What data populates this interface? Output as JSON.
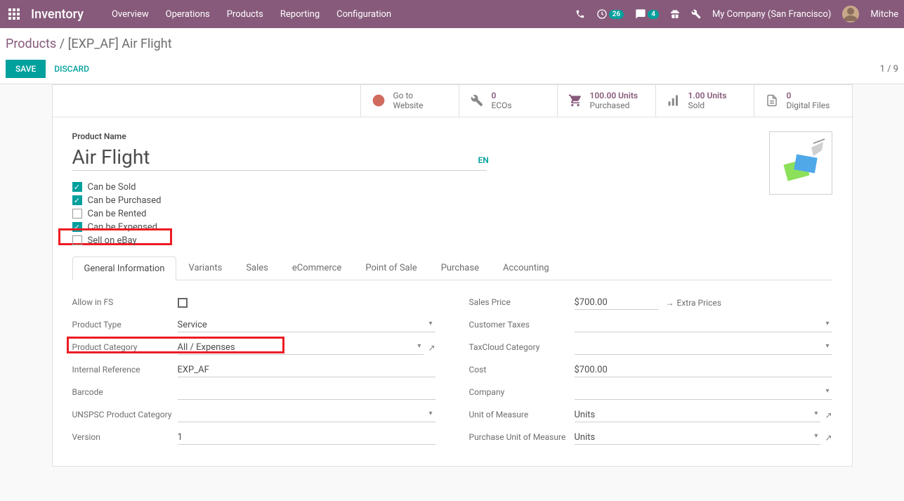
{
  "navbar": {
    "brand": "Inventory",
    "menu": [
      "Overview",
      "Operations",
      "Products",
      "Reporting",
      "Configuration"
    ],
    "activities_count": "26",
    "messages_count": "4",
    "company": "My Company (San Francisco)",
    "username": "Mitche"
  },
  "breadcrumb": {
    "root": "Products",
    "sep": " / ",
    "current": "[EXP_AF] Air Flight"
  },
  "actions": {
    "save": "SAVE",
    "discard": "DISCARD",
    "pager": "1 / 9"
  },
  "stats": {
    "website": {
      "l1": "Go to",
      "l2": "Website"
    },
    "ecos": {
      "val": "0",
      "lbl": "ECOs"
    },
    "purchased": {
      "val": "100.00 Units",
      "lbl": "Purchased"
    },
    "sold": {
      "val": "1.00 Units",
      "lbl": "Sold"
    },
    "files": {
      "val": "0",
      "lbl": "Digital Files"
    }
  },
  "product": {
    "name_label": "Product Name",
    "name": "Air Flight",
    "lang": "EN"
  },
  "checks": {
    "sold": "Can be Sold",
    "purchased": "Can be Purchased",
    "rented": "Can be Rented",
    "expensed": "Can be Expensed",
    "ebay": "Sell on eBay"
  },
  "tabs": [
    "General Information",
    "Variants",
    "Sales",
    "eCommerce",
    "Point of Sale",
    "Purchase",
    "Accounting"
  ],
  "left_fields": {
    "allow_fs": "Allow in FS",
    "product_type": {
      "label": "Product Type",
      "value": "Service"
    },
    "product_category": {
      "label": "Product Category",
      "value": "All / Expenses"
    },
    "internal_ref": {
      "label": "Internal Reference",
      "value": "EXP_AF"
    },
    "barcode": {
      "label": "Barcode",
      "value": ""
    },
    "unspsc": {
      "label": "UNSPSC Product Category",
      "value": ""
    },
    "version": {
      "label": "Version",
      "value": "1"
    }
  },
  "right_fields": {
    "sales_price": {
      "label": "Sales Price",
      "value": "$700.00"
    },
    "extra_prices": "Extra Prices",
    "customer_taxes": {
      "label": "Customer Taxes",
      "value": ""
    },
    "taxcloud": {
      "label": "TaxCloud Category",
      "value": ""
    },
    "cost": {
      "label": "Cost",
      "value": "$700.00"
    },
    "company": {
      "label": "Company",
      "value": ""
    },
    "uom": {
      "label": "Unit of Measure",
      "value": "Units"
    },
    "purchase_uom": {
      "label": "Purchase Unit of Measure",
      "value": "Units"
    }
  }
}
